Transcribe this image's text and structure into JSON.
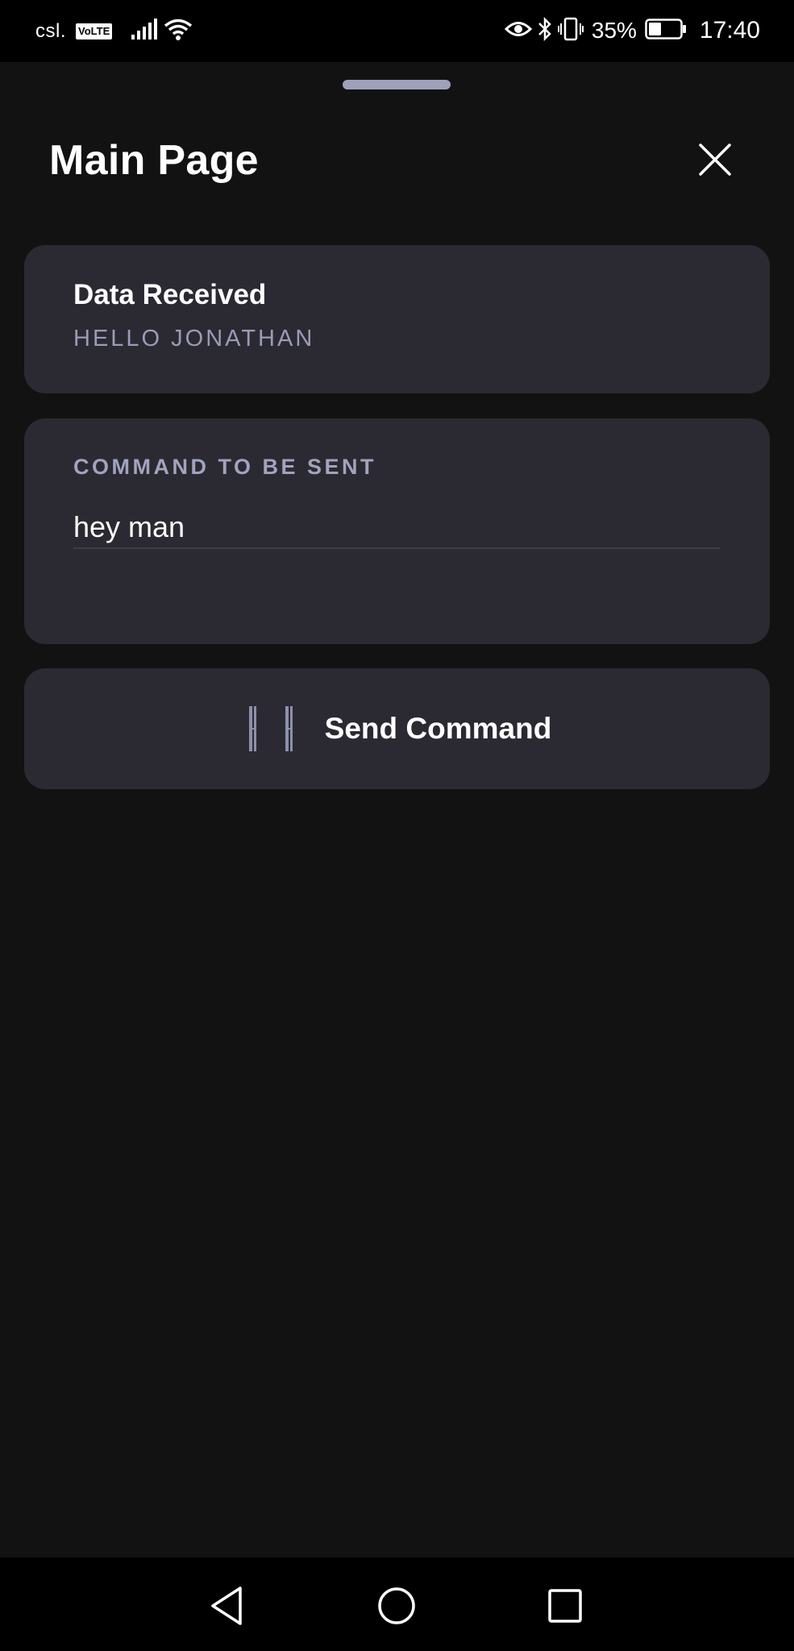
{
  "status_bar": {
    "carrier": "csl.",
    "volte": "VoLTE",
    "battery_percent": "35%",
    "time": "17:40",
    "icons": [
      "signal-icon",
      "wifi-icon",
      "eye-icon",
      "bluetooth-icon",
      "vibrate-icon",
      "battery-icon"
    ]
  },
  "header": {
    "title": "Main Page",
    "close_icon": "close-icon"
  },
  "received": {
    "title": "Data Received",
    "value": "HELLO JONATHAN"
  },
  "command": {
    "label": "COMMAND TO BE SENT",
    "value": "hey man"
  },
  "send": {
    "label": "Send Command",
    "icon": "send-icon"
  },
  "nav": {
    "icons": [
      "back-icon",
      "home-icon",
      "recents-icon"
    ]
  },
  "colors": {
    "background": "#121212",
    "card": "#2b2a32",
    "accent_text": "#9a9bb6",
    "handle": "#9ea0bc"
  }
}
